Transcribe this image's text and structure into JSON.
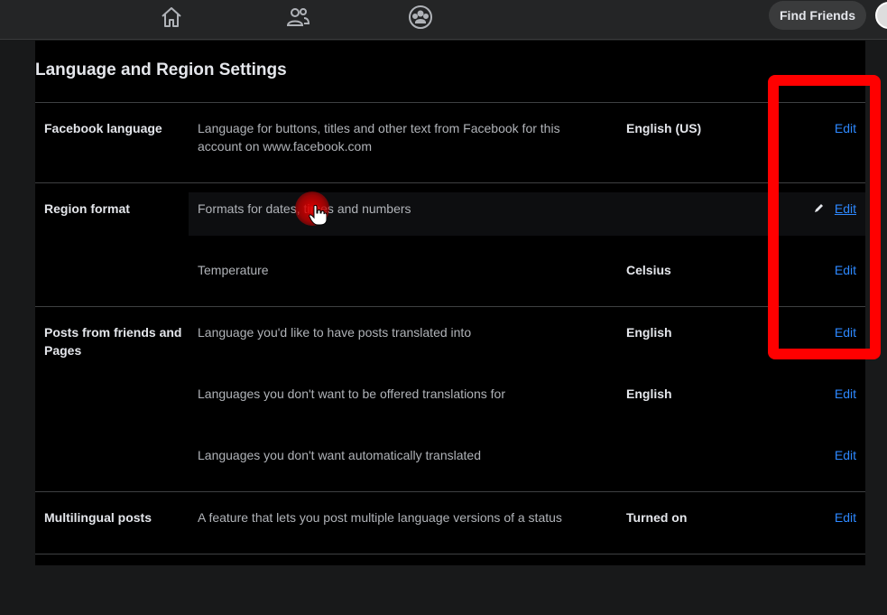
{
  "header": {
    "nav": [
      {
        "name": "home-icon"
      },
      {
        "name": "friends-icon"
      },
      {
        "name": "groups-icon"
      }
    ],
    "find_friends_label": "Find Friends"
  },
  "page": {
    "title": "Language and Region Settings"
  },
  "sections": {
    "facebook_language": {
      "label": "Facebook language",
      "desc": "Language for buttons, titles and other text from Facebook for this account on www.facebook.com",
      "value": "English (US)",
      "edit": "Edit"
    },
    "region_format": {
      "label": "Region format",
      "rows": [
        {
          "desc": "Formats for dates, times and numbers",
          "value": "",
          "edit": "Edit"
        },
        {
          "desc": "Temperature",
          "value": "Celsius",
          "edit": "Edit"
        }
      ]
    },
    "posts_translation": {
      "label": "Posts from friends and Pages",
      "rows": [
        {
          "desc": "Language you'd like to have posts translated into",
          "value": "English",
          "edit": "Edit"
        },
        {
          "desc": "Languages you don't want to be offered translations for",
          "value": "English",
          "edit": "Edit"
        },
        {
          "desc": "Languages you don't want automatically translated",
          "value": "",
          "edit": "Edit"
        }
      ]
    },
    "multilingual_posts": {
      "label": "Multilingual posts",
      "desc": "A feature that lets you post multiple language versions of a status",
      "value": "Turned on",
      "edit": "Edit"
    }
  },
  "colors": {
    "accent_link": "#2d88ff",
    "annotation_box": "#ff0000"
  }
}
